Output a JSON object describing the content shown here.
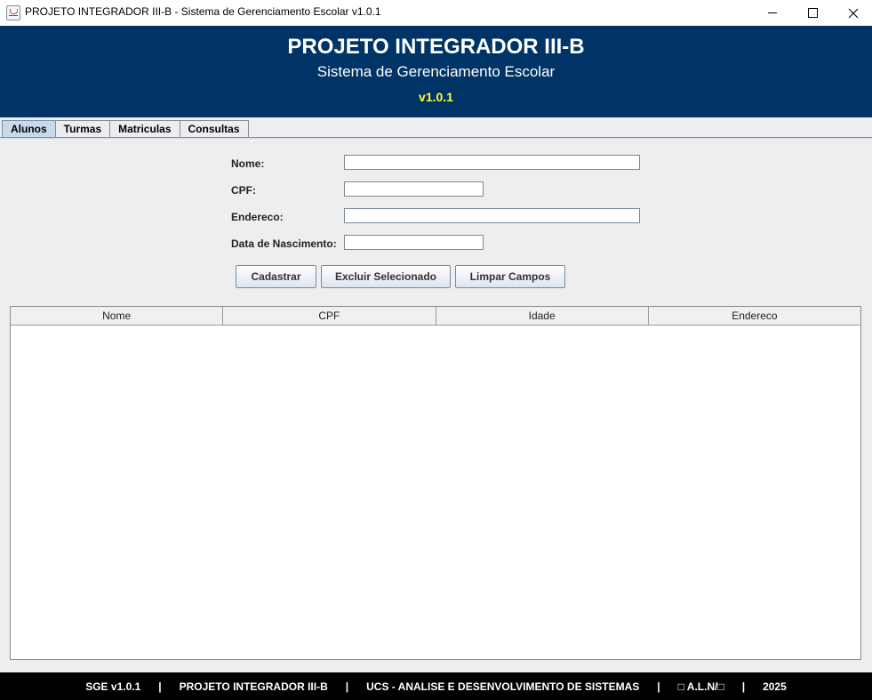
{
  "window": {
    "title": "PROJETO INTEGRADOR III-B - Sistema de Gerenciamento Escolar v1.0.1"
  },
  "banner": {
    "title": "PROJETO INTEGRADOR III-B",
    "subtitle": "Sistema de Gerenciamento Escolar",
    "version": "v1.0.1"
  },
  "tabs": [
    {
      "label": "Alunos",
      "active": true
    },
    {
      "label": "Turmas",
      "active": false
    },
    {
      "label": "Matriculas",
      "active": false
    },
    {
      "label": "Consultas",
      "active": false
    }
  ],
  "form": {
    "nome_label": "Nome:",
    "nome_value": "",
    "cpf_label": "CPF:",
    "cpf_value": "",
    "endereco_label": "Endereco:",
    "endereco_value": "",
    "nascimento_label": "Data de Nascimento:",
    "nascimento_value": ""
  },
  "buttons": {
    "cadastrar": "Cadastrar",
    "excluir": "Excluir Selecionado",
    "limpar": "Limpar Campos"
  },
  "table": {
    "columns": [
      "Nome",
      "CPF",
      "Idade",
      "Endereco"
    ],
    "rows": []
  },
  "footer": {
    "items": [
      "SGE v1.0.1",
      "PROJETO INTEGRADOR III-B",
      "UCS - ANALISE E DESENVOLVIMENTO DE SISTEMAS",
      "□ A.L.N/□",
      "2025"
    ],
    "separator": "|"
  },
  "colors": {
    "banner_bg": "#003366",
    "version_text": "#ffff33",
    "active_tab": "#c8d9eb",
    "footer_bg": "#000000"
  }
}
